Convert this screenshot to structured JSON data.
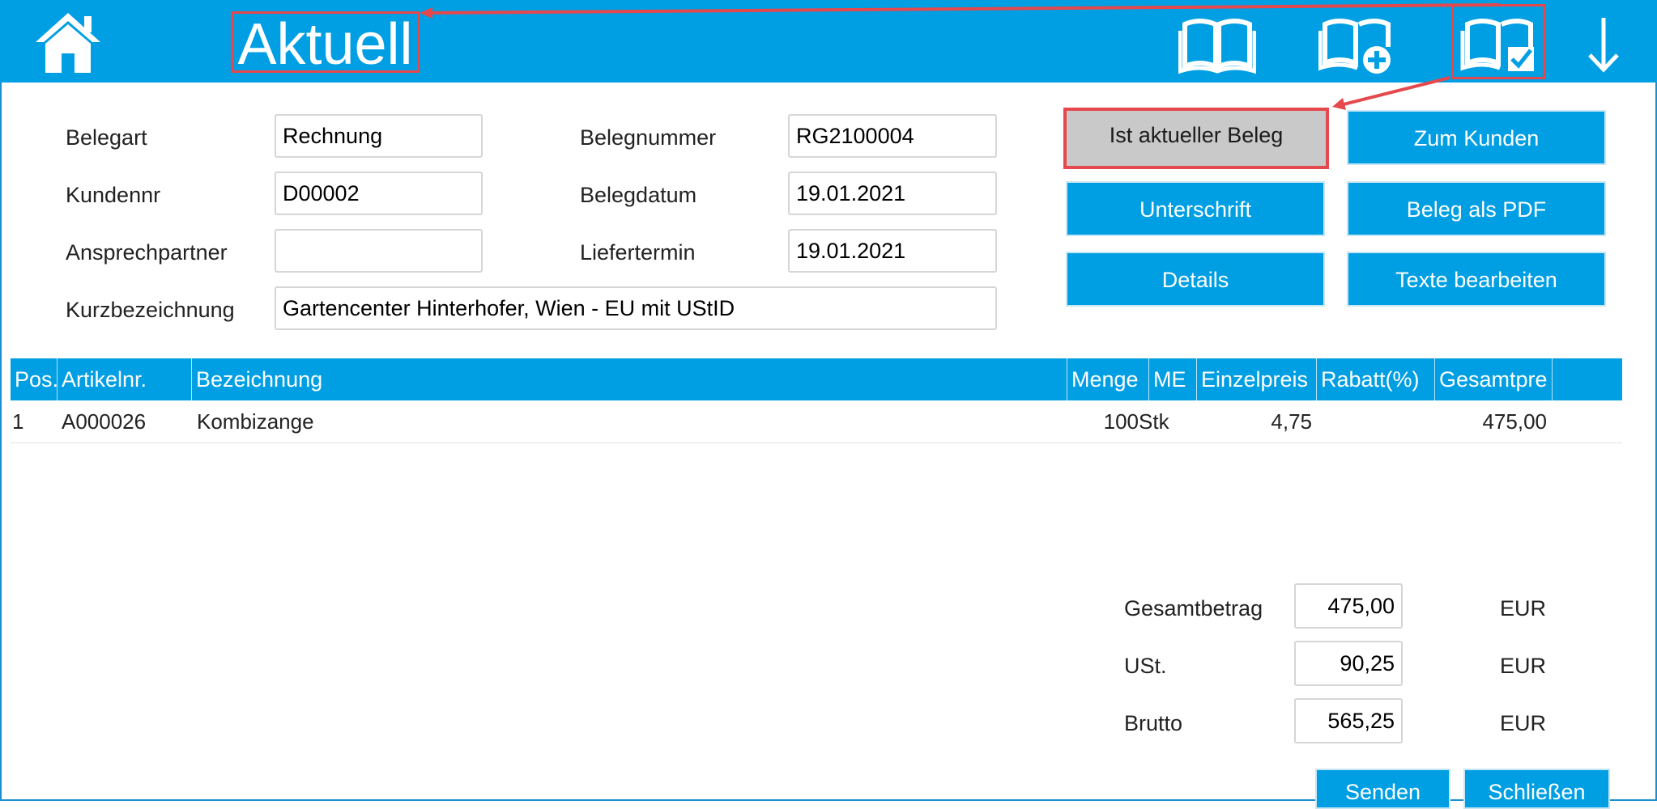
{
  "header": {
    "title": "Aktuell",
    "icons": [
      "home-icon",
      "book-icon",
      "book-add-icon",
      "book-check-icon",
      "arrow-down-icon"
    ]
  },
  "form": {
    "belegart": {
      "label": "Belegart",
      "value": "Rechnung"
    },
    "kundennr": {
      "label": "Kundennr",
      "value": "D00002"
    },
    "ansprechpartner": {
      "label": "Ansprechpartner",
      "value": ""
    },
    "kurzbezeichnung": {
      "label": "Kurzbezeichnung",
      "value": "Gartencenter Hinterhofer, Wien - EU mit UStID"
    },
    "belegnummer": {
      "label": "Belegnummer",
      "value": "RG2100004"
    },
    "belegdatum": {
      "label": "Belegdatum",
      "value": "19.01.2021"
    },
    "liefertermin": {
      "label": "Liefertermin",
      "value": "19.01.2021"
    }
  },
  "actions": {
    "current": "Ist aktueller Beleg",
    "customer": "Zum Kunden",
    "signature": "Unterschrift",
    "pdf": "Beleg als PDF",
    "details": "Details",
    "texts": "Texte bearbeiten"
  },
  "table": {
    "columns": [
      "Pos.",
      "Artikelnr.",
      "Bezeichnung",
      "Menge",
      "ME",
      "Einzelpreis",
      "Rabatt(%)",
      "Gesamtpre"
    ],
    "rows": [
      {
        "pos": "1",
        "artikelnr": "A000026",
        "bezeichnung": "Kombizange",
        "menge": "100",
        "me": "Stk",
        "einzelpreis": "4,75",
        "rabatt": "",
        "gesamt": "475,00"
      }
    ]
  },
  "totals": {
    "gesamt": {
      "label": "Gesamtbetrag",
      "value": "475,00",
      "currency": "EUR"
    },
    "ust": {
      "label": "USt.",
      "value": "90,25",
      "currency": "EUR"
    },
    "brutto": {
      "label": "Brutto",
      "value": "565,25",
      "currency": "EUR"
    }
  },
  "footer": {
    "send": "Senden",
    "close": "Schließen"
  },
  "colors": {
    "accent": "#009fe3",
    "highlight": "#e5484d",
    "button_current": "#c9c9c9"
  }
}
